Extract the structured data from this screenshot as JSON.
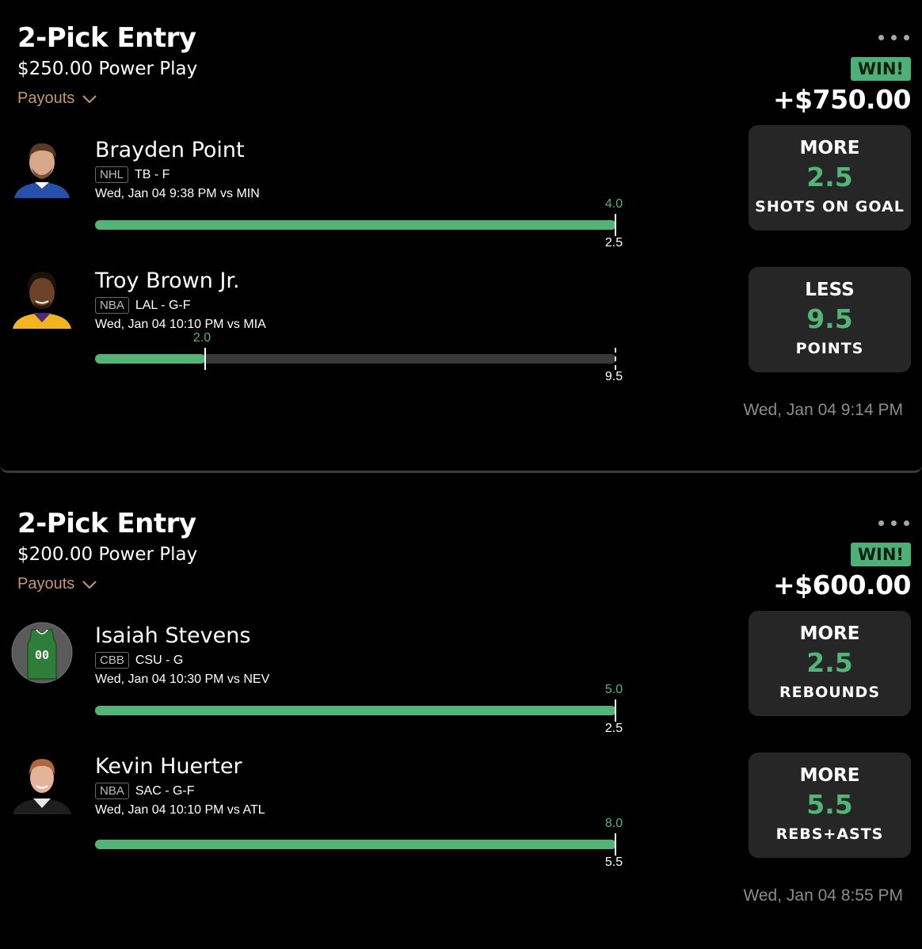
{
  "entries": [
    {
      "title": "2-Pick Entry",
      "subtitle": "$250.00 Power Play",
      "payouts_label": "Payouts",
      "result": "WIN!",
      "amount": "+$750.00",
      "timestamp": "Wed, Jan 04 9:14 PM",
      "picks": [
        {
          "name": "Brayden Point",
          "league": "NHL",
          "team_pos": "TB - F",
          "game": "Wed, Jan 04 9:38 PM  vs MIN",
          "direction": "MORE",
          "line": "2.5",
          "stat": "SHOTS ON GOAL",
          "actual": "4.0",
          "line_label": "2.5",
          "progress": 1.0,
          "avatar": "player-headshot-blue-jersey"
        },
        {
          "name": "Troy Brown Jr.",
          "league": "NBA",
          "team_pos": "LAL - G-F",
          "game": "Wed, Jan 04 10:10 PM  vs MIA",
          "direction": "LESS",
          "line": "9.5",
          "stat": "POINTS",
          "actual": "2.0",
          "line_label": "9.5",
          "progress": 0.21,
          "avatar": "player-headshot-gold-jersey"
        }
      ]
    },
    {
      "title": "2-Pick Entry",
      "subtitle": "$200.00 Power Play",
      "payouts_label": "Payouts",
      "result": "WIN!",
      "amount": "+$600.00",
      "timestamp": "Wed, Jan 04 8:55 PM",
      "picks": [
        {
          "name": "Isaiah Stevens",
          "league": "CBB",
          "team_pos": "CSU - G",
          "game": "Wed, Jan 04 10:30 PM  vs NEV",
          "direction": "MORE",
          "line": "2.5",
          "stat": "REBOUNDS",
          "actual": "5.0",
          "line_label": "2.5",
          "progress": 1.0,
          "avatar": "jersey-placeholder",
          "jersey_number": "00"
        },
        {
          "name": "Kevin Huerter",
          "league": "NBA",
          "team_pos": "SAC - G-F",
          "game": "Wed, Jan 04 10:10 PM  vs ATL",
          "direction": "MORE",
          "line": "5.5",
          "stat": "REBS+ASTS",
          "actual": "8.0",
          "line_label": "5.5",
          "progress": 1.0,
          "avatar": "player-headshot-black-jersey"
        }
      ]
    }
  ],
  "colors": {
    "accent_green": "#52b576",
    "win_badge": "#4eb077",
    "payouts": "#c89a62",
    "card_bg": "#262626"
  }
}
